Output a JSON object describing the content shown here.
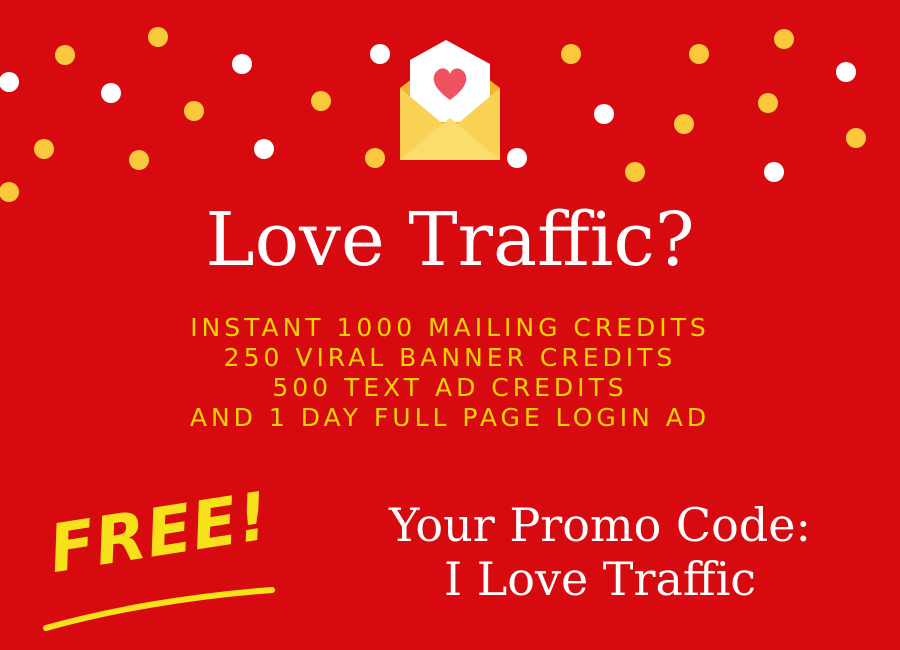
{
  "banner": {
    "headline": "Love Traffic?",
    "offer_lines": [
      "INSTANT 1000 MAILING CREDITS",
      "250 VIRAL BANNER CREDITS",
      "500 TEXT AD CREDITS",
      "AND 1 DAY FULL PAGE LOGIN AD"
    ],
    "free_label": "FREE!",
    "promo_label": "Your Promo Code:",
    "promo_code": "I Love Traffic"
  },
  "theme": {
    "background": "#d70a10",
    "headline_color": "#ffffff",
    "offer_color": "#f5d400",
    "free_color": "#f7e11a",
    "dot_yellow": "#f9c93b",
    "dot_white": "#ffffff"
  },
  "decor": {
    "envelope_icon": "love-letter-envelope-icon",
    "confetti": "confetti-dots"
  }
}
